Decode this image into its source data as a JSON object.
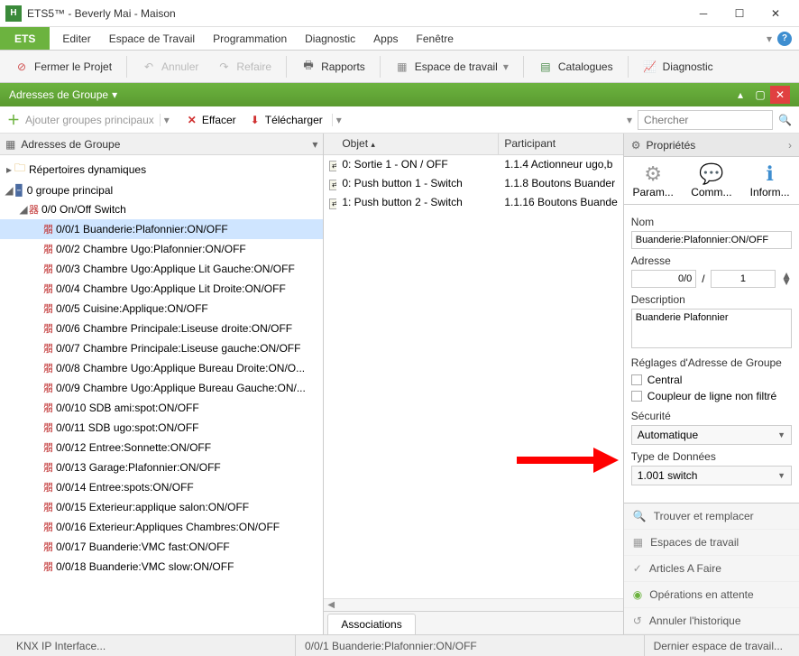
{
  "window": {
    "title": "ETS5™ - Beverly Mai - Maison"
  },
  "menu": {
    "ets": "ETS",
    "items": [
      "Editer",
      "Espace de Travail",
      "Programmation",
      "Diagnostic",
      "Apps",
      "Fenêtre"
    ]
  },
  "toolbar": {
    "close_project": "Fermer le Projet",
    "undo": "Annuler",
    "redo": "Refaire",
    "reports": "Rapports",
    "workspace": "Espace de travail",
    "catalogs": "Catalogues",
    "diagnostic": "Diagnostic"
  },
  "panel": {
    "title": "Adresses de Groupe"
  },
  "subtoolbar": {
    "add": "Ajouter groupes principaux",
    "delete": "Effacer",
    "download": "Télécharger",
    "search_placeholder": "Chercher"
  },
  "tree": {
    "header": "Adresses de Groupe",
    "dynamic": "Répertoires dynamiques",
    "main_group": "0 groupe principal",
    "mid_group": "0/0 On/Off Switch",
    "items": [
      {
        "addr": "0/0/1",
        "label": "Buanderie:Plafonnier:ON/OFF",
        "selected": true
      },
      {
        "addr": "0/0/2",
        "label": "Chambre Ugo:Plafonnier:ON/OFF"
      },
      {
        "addr": "0/0/3",
        "label": "Chambre Ugo:Applique Lit Gauche:ON/OFF"
      },
      {
        "addr": "0/0/4",
        "label": "Chambre Ugo:Applique Lit Droite:ON/OFF"
      },
      {
        "addr": "0/0/5",
        "label": "Cuisine:Applique:ON/OFF"
      },
      {
        "addr": "0/0/6",
        "label": "Chambre Principale:Liseuse droite:ON/OFF"
      },
      {
        "addr": "0/0/7",
        "label": "Chambre Principale:Liseuse gauche:ON/OFF"
      },
      {
        "addr": "0/0/8",
        "label": "Chambre Ugo:Applique Bureau Droite:ON/O..."
      },
      {
        "addr": "0/0/9",
        "label": "Chambre Ugo:Applique Bureau Gauche:ON/..."
      },
      {
        "addr": "0/0/10",
        "label": "SDB ami:spot:ON/OFF"
      },
      {
        "addr": "0/0/11",
        "label": "SDB ugo:spot:ON/OFF"
      },
      {
        "addr": "0/0/12",
        "label": "Entree:Sonnette:ON/OFF"
      },
      {
        "addr": "0/0/13",
        "label": "Garage:Plafonnier:ON/OFF"
      },
      {
        "addr": "0/0/14",
        "label": "Entree:spots:ON/OFF"
      },
      {
        "addr": "0/0/15",
        "label": "Exterieur:applique salon:ON/OFF"
      },
      {
        "addr": "0/0/16",
        "label": "Exterieur:Appliques Chambres:ON/OFF"
      },
      {
        "addr": "0/0/17",
        "label": "Buanderie:VMC fast:ON/OFF"
      },
      {
        "addr": "0/0/18",
        "label": "Buanderie:VMC slow:ON/OFF"
      }
    ]
  },
  "table": {
    "col_object": "Objet",
    "col_participant": "Participant",
    "rows": [
      {
        "obj": "0: Sortie 1 - ON / OFF",
        "part": "1.1.4 Actionneur ugo,b"
      },
      {
        "obj": "0: Push button 1 - Switch",
        "part": "1.1.8 Boutons Buander"
      },
      {
        "obj": "1: Push button 2 - Switch",
        "part": "1.1.16 Boutons Buande"
      }
    ],
    "tab": "Associations"
  },
  "props": {
    "title": "Propriétés",
    "tab_param": "Param...",
    "tab_comm": "Comm...",
    "tab_info": "Inform...",
    "lbl_name": "Nom",
    "val_name": "Buanderie:Plafonnier:ON/OFF",
    "lbl_addr": "Adresse",
    "addr_main": "0/0",
    "addr_sub": "1",
    "lbl_desc": "Description",
    "val_desc": "Buanderie Plafonnier",
    "lbl_settings": "Réglages d'Adresse de Groupe",
    "cb_central": "Central",
    "cb_coupler": "Coupleur de ligne non filtré",
    "lbl_security": "Sécurité",
    "val_security": "Automatique",
    "lbl_dpt": "Type de Données",
    "val_dpt": "1.001 switch"
  },
  "sidelinks": {
    "find": "Trouver et remplacer",
    "workspaces": "Espaces de travail",
    "todo": "Articles A Faire",
    "pending": "Opérations en attente",
    "undo_history": "Annuler l'historique"
  },
  "status": {
    "interface": "KNX IP Interface...",
    "sel": "0/0/1 Buanderie:Plafonnier:ON/OFF",
    "last": "Dernier espace de travail..."
  }
}
